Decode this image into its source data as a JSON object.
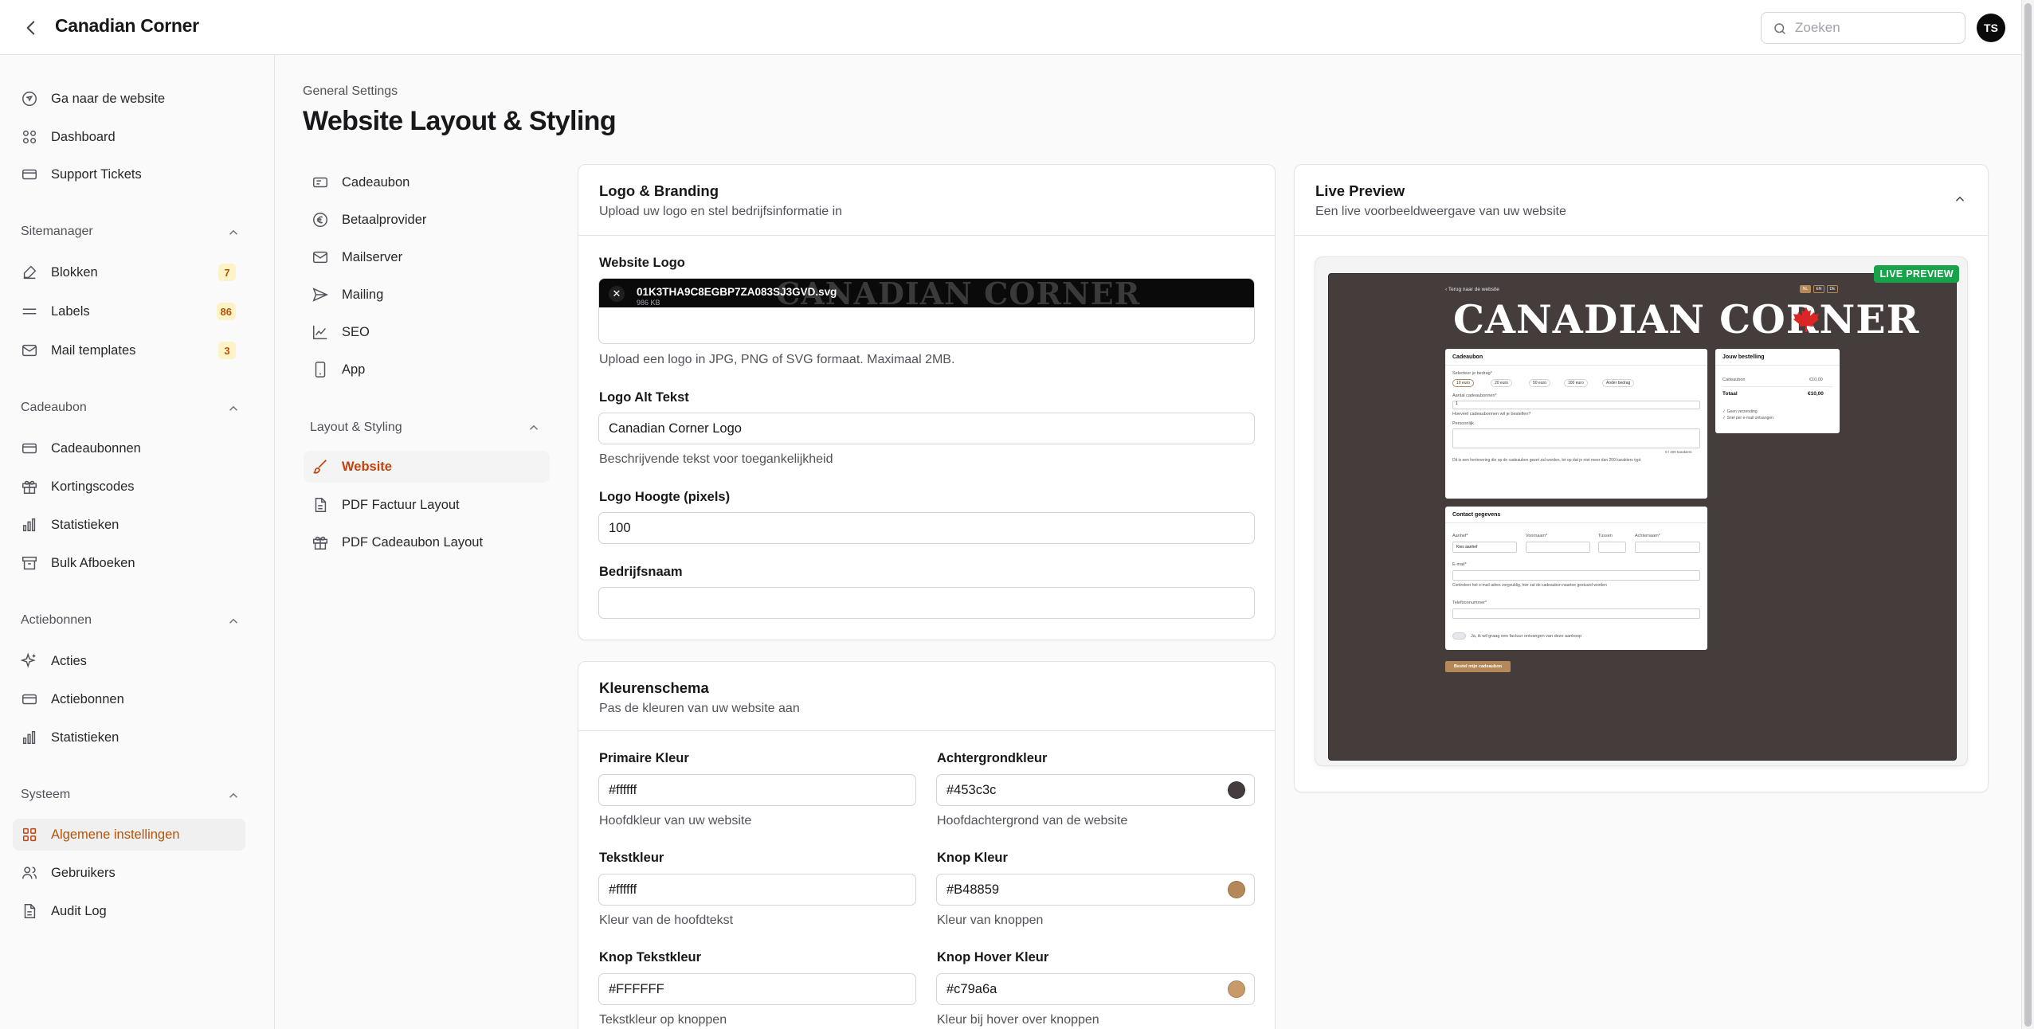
{
  "topbar": {
    "title": "Canadian Corner",
    "search_placeholder": "Zoeken",
    "avatar_initials": "TS"
  },
  "sidebar": {
    "top_items": [
      {
        "label": "Ga naar de website",
        "icon": "external-site-icon"
      },
      {
        "label": "Dashboard",
        "icon": "dashboard-icon"
      },
      {
        "label": "Support Tickets",
        "icon": "ticket-icon"
      }
    ],
    "sections": [
      {
        "title": "Sitemanager",
        "items": [
          {
            "label": "Blokken",
            "icon": "edit-icon",
            "badge": "7"
          },
          {
            "label": "Labels",
            "icon": "lines-icon",
            "badge": "86"
          },
          {
            "label": "Mail templates",
            "icon": "mail-icon",
            "badge": "3"
          }
        ]
      },
      {
        "title": "Cadeaubon",
        "items": [
          {
            "label": "Cadeaubonnen",
            "icon": "ticket-icon"
          },
          {
            "label": "Kortingscodes",
            "icon": "gift-icon"
          },
          {
            "label": "Statistieken",
            "icon": "chart-icon"
          },
          {
            "label": "Bulk Afboeken",
            "icon": "archive-icon"
          }
        ]
      },
      {
        "title": "Actiebonnen",
        "items": [
          {
            "label": "Acties",
            "icon": "sparkle-icon"
          },
          {
            "label": "Actiebonnen",
            "icon": "ticket-icon"
          },
          {
            "label": "Statistieken",
            "icon": "chart-icon"
          }
        ]
      },
      {
        "title": "Systeem",
        "items": [
          {
            "label": "Algemene instellingen",
            "icon": "grid-icon",
            "active": true
          },
          {
            "label": "Gebruikers",
            "icon": "users-icon"
          },
          {
            "label": "Audit Log",
            "icon": "file-icon"
          }
        ]
      }
    ]
  },
  "main": {
    "breadcrumb": "General Settings",
    "title": "Website Layout & Styling"
  },
  "subnav": {
    "items": [
      {
        "label": "Cadeaubon",
        "icon": "ticket-icon"
      },
      {
        "label": "Betaalprovider",
        "icon": "euro-icon"
      },
      {
        "label": "Mailserver",
        "icon": "mail-icon"
      },
      {
        "label": "Mailing",
        "icon": "send-icon"
      },
      {
        "label": "SEO",
        "icon": "chart-line-icon"
      },
      {
        "label": "App",
        "icon": "phone-icon"
      }
    ],
    "section_title": "Layout & Styling",
    "section_items": [
      {
        "label": "Website",
        "icon": "brush-icon",
        "active": true
      },
      {
        "label": "PDF Factuur Layout",
        "icon": "file-icon"
      },
      {
        "label": "PDF Cadeaubon Layout",
        "icon": "gift-icon"
      }
    ]
  },
  "branding": {
    "title": "Logo & Branding",
    "description": "Upload uw logo en stel bedrijfsinformatie in",
    "logo_label": "Website Logo",
    "logo_file_name": "01K3THA9C8EGBP7ZA083SJ3GVD.svg",
    "logo_file_size": "986 KB",
    "logo_ghost_text": "CANADIAN CORNER",
    "logo_hint": "Upload een logo in JPG, PNG of SVG formaat. Maximaal 2MB.",
    "alt_label": "Logo Alt Tekst",
    "alt_value": "Canadian Corner Logo",
    "alt_hint": "Beschrijvende tekst voor toegankelijkheid",
    "height_label": "Logo Hoogte (pixels)",
    "height_value": "100",
    "company_label": "Bedrijfsnaam",
    "company_value": ""
  },
  "colors": {
    "title": "Kleurenschema",
    "description": "Pas de kleuren van uw website aan",
    "fields": [
      {
        "label": "Primaire Kleur",
        "value": "#ffffff",
        "hint": "Hoofdkleur van uw website",
        "swatch": null
      },
      {
        "label": "Achtergrondkleur",
        "value": "#453c3c",
        "hint": "Hoofdachtergrond van de website",
        "swatch": "#453c3c"
      },
      {
        "label": "Tekstkleur",
        "value": "#ffffff",
        "hint": "Kleur van de hoofdtekst",
        "swatch": null
      },
      {
        "label": "Knop Kleur",
        "value": "#B48859",
        "hint": "Kleur van knoppen",
        "swatch": "#B48859"
      },
      {
        "label": "Knop Tekstkleur",
        "value": "#FFFFFF",
        "hint": "Tekstkleur op knoppen",
        "swatch": null
      },
      {
        "label": "Knop Hover Kleur",
        "value": "#c79a6a",
        "hint": "Kleur bij hover over knoppen",
        "swatch": "#c79a6a"
      }
    ]
  },
  "preview": {
    "title": "Live Preview",
    "description": "Een live voorbeeldweergave van uw website",
    "badge": "LIVE PREVIEW",
    "back_link": "‹ Terug naar de website",
    "langs": [
      "NL",
      "EN",
      "DE"
    ],
    "logo": "CANADIAN CORNER",
    "voucher_title": "Cadeaubon",
    "amount_label": "Selecteer je bedrag*",
    "amounts": [
      "10 euro",
      "20 euro",
      "50 euro",
      "100 euro",
      "Ander bedrag"
    ],
    "count_label": "Aantal cadeaubonnen*",
    "count_value": "1",
    "count_hint": "Hoeveel cadeaubonnen wil je bestellen?",
    "message_label": "Persoonlijk",
    "message_counter": "0 / 200 karakters",
    "message_hint": "Dit is een herinnering die op de cadeaubon gezet zal worden, let op dat je niet meer dan 200 karakters typt",
    "order_title": "Jouw bestelling",
    "order_item_label": "Cadeaubon",
    "order_item_value": "€10,00",
    "order_total_label": "Totaal",
    "order_total_value": "€10,00",
    "order_note_1": "✓ Geen verzending",
    "order_note_2": "✓ Snel per e-mail ontvangen",
    "contact_title": "Contact gegevens",
    "salutation_label": "Aanhef*",
    "salutation_value": "Kies aanhef",
    "firstname_label": "Voornaam*",
    "infix_label": "Tussen",
    "lastname_label": "Achternaam*",
    "email_label": "E-mail*",
    "email_hint": "Controleer het e-mail adres zorgvuldig, hier zal de cadeaubon naartoe gestuurd worden",
    "phone_label": "Telefoonnummer*",
    "invoice_label": "Ja, ik wil graag een factuur ontvangen van deze aankoop",
    "submit_label": "Bestel mijn cadeaubon"
  }
}
